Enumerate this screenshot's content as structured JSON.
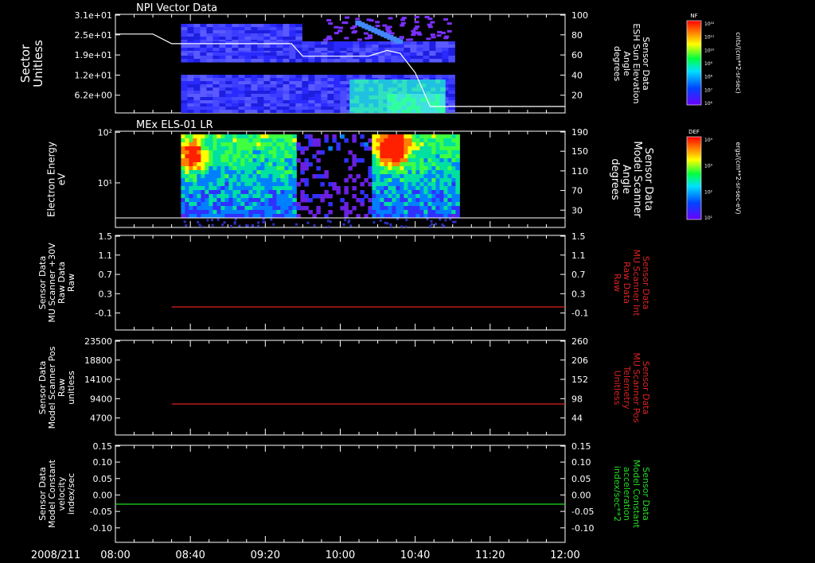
{
  "date_label": "2008/211",
  "time_ticks": [
    "08:00",
    "08:40",
    "09:20",
    "10:00",
    "10:40",
    "11:20",
    "12:00"
  ],
  "colors": {
    "background": "#000000",
    "axes": "#ffffff",
    "red_series": "#dd2222",
    "green_series": "#22dd22"
  },
  "panels": [
    {
      "title": "NPI Vector Data",
      "left_label": [
        "Sector",
        "Unitless"
      ],
      "left_ticks": [
        "3.1e+01",
        "2.5e+01",
        "1.9e+01",
        "1.2e+01",
        "6.2e+00"
      ],
      "right_label": [
        "Sensor Data",
        "ESH Sun Elevation",
        "Angle",
        "degrees"
      ],
      "right_ticks": [
        "100",
        "80",
        "60",
        "40",
        "20"
      ],
      "right_label_color": "#ffffff"
    },
    {
      "title": "MEx ELS-01 LR",
      "left_label": [
        "Electron Energy",
        "eV"
      ],
      "left_ticks": [
        "10²",
        "10¹"
      ],
      "right_label": [
        "Sensor Data",
        "Model Scanner",
        "Angle",
        "degrees"
      ],
      "right_ticks": [
        "190",
        "150",
        "110",
        "70",
        "30"
      ],
      "right_label_color": "#ffffff"
    },
    {
      "title": "",
      "left_label": [
        "Sensor Data",
        "MU Scanner +30V",
        "Raw Data",
        "Raw"
      ],
      "left_ticks": [
        "1.5",
        "1.1",
        "0.7",
        "0.3",
        "-0.1"
      ],
      "right_label": [
        "Sensor Data",
        "MU Scanner Int",
        "Raw Data",
        "Raw"
      ],
      "right_ticks": [
        "1.5",
        "1.1",
        "0.7",
        "0.3",
        "-0.1"
      ],
      "right_label_color": "#dd2222"
    },
    {
      "title": "",
      "left_label": [
        "Sensor Data",
        "Model Scanner Pos",
        "Raw",
        "unitless"
      ],
      "left_ticks": [
        "23500",
        "18800",
        "14100",
        "9400",
        "4700"
      ],
      "right_label": [
        "Sensor Data",
        "MU Scanner Pos",
        "Telemetry",
        "Unitless"
      ],
      "right_ticks": [
        "260",
        "206",
        "152",
        "98",
        "44"
      ],
      "right_label_color": "#dd2222"
    },
    {
      "title": "",
      "left_label": [
        "Sensor Data",
        "Model Constant",
        "velocity",
        "index/sec"
      ],
      "left_ticks": [
        "0.15",
        "0.10",
        "0.05",
        "0.00",
        "-0.05",
        "-0.10"
      ],
      "right_label": [
        "Sensor Data",
        "Model Constant",
        "acceleration",
        "index/sec**2"
      ],
      "right_ticks": [
        "0.15",
        "0.10",
        "0.05",
        "0.00",
        "-0.05",
        "-0.10"
      ],
      "right_label_color": "#22dd22"
    }
  ],
  "colorbars": [
    {
      "title": "NF",
      "unit": "cnts/(cm**2-sr-sec)",
      "ticks": [
        "10¹²",
        "10¹¹",
        "10¹⁰",
        "10⁹",
        "10⁸",
        "10⁷",
        "10⁶"
      ]
    },
    {
      "title": "DEF",
      "unit": "ergs/(cm**2-sr-sec-eV)",
      "ticks": [
        "10⁴",
        "10³",
        "10²",
        "10¹"
      ]
    }
  ],
  "chart_data": [
    {
      "type": "heatmap",
      "title": "NPI Vector Data",
      "ylabel": "Sector Unitless",
      "right_ylabel": "Sensor Data ESH Sun Elevation Angle degrees",
      "x_range": [
        "08:00",
        "12:00"
      ],
      "line": {
        "name": "ESH Sun Elevation Angle",
        "x": [
          "08:00",
          "08:20",
          "08:30",
          "09:00",
          "09:34",
          "09:40",
          "10:15",
          "10:25",
          "10:32",
          "10:40",
          "10:48",
          "12:00"
        ],
        "y": [
          80,
          80,
          70,
          70,
          70,
          57,
          57,
          63,
          60,
          40,
          5,
          5
        ]
      },
      "ylim_right": [
        0,
        100
      ]
    },
    {
      "type": "heatmap",
      "title": "MEx ELS-01 LR",
      "ylabel": "Electron Energy eV",
      "right_ylabel": "Sensor Data Model Scanner Angle degrees",
      "x_range": [
        "08:00",
        "12:00"
      ],
      "data_span": [
        "08:35",
        "11:03"
      ],
      "line": {
        "name": "Model Scanner Angle",
        "y": 10
      },
      "ylim_right": [
        0,
        190
      ]
    },
    {
      "type": "line",
      "ylabel": "Sensor Data MU Scanner +30V Raw Data Raw",
      "right_ylabel": "Sensor Data MU Scanner Int Raw Data Raw",
      "ylim": [
        -0.3,
        1.5
      ],
      "series": [
        {
          "x": [
            "08:30",
            "12:00"
          ],
          "y": [
            0.1,
            0.1
          ]
        }
      ]
    },
    {
      "type": "line",
      "ylabel": "Sensor Data Model Scanner Pos Raw unitless",
      "right_ylabel": "Sensor Data MU Scanner Pos Telemetry Unitless",
      "ylim_right": [
        0,
        280
      ],
      "series": [
        {
          "x": [
            "08:30",
            "12:00"
          ],
          "y": [
            90,
            90
          ]
        }
      ]
    },
    {
      "type": "line",
      "ylabel": "Sensor Data Model Constant velocity index/sec",
      "right_ylabel": "Sensor Data Model Constant acceleration index/sec**2",
      "ylim": [
        -0.1,
        0.15
      ],
      "series": [
        {
          "x": [
            "08:00",
            "12:00"
          ],
          "y": [
            0.0,
            0.0
          ]
        }
      ]
    }
  ]
}
